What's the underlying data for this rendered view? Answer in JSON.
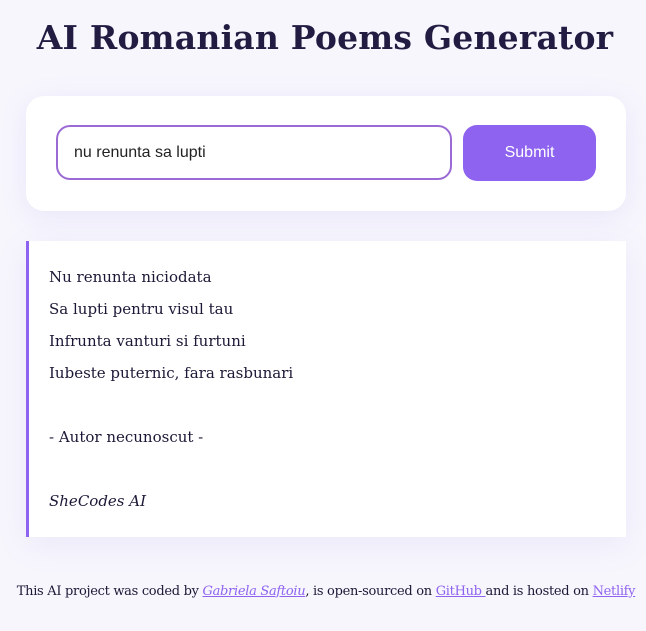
{
  "header": {
    "title": "AI Romanian Poems Generator"
  },
  "search": {
    "value": "nu renunta sa lupti",
    "submit_label": "Submit"
  },
  "poem": {
    "lines": [
      "Nu renunta niciodata",
      "Sa lupti pentru visul tau",
      "Infrunta vanturi si furtuni",
      "Iubeste puternic, fara rasbunari"
    ],
    "author": "- Autor necunoscut -",
    "signature": "SheCodes AI"
  },
  "footer": {
    "text_1": "This AI project was coded by ",
    "author_link": "Gabriela Saftoiu",
    "text_2": ", is open-sourced on ",
    "github_link": "GitHub ",
    "text_3": "and is hosted on ",
    "netlify_link": "Netlify"
  },
  "colors": {
    "accent": "#8e63f0",
    "background": "#f7f6fd",
    "title": "#221c42"
  }
}
